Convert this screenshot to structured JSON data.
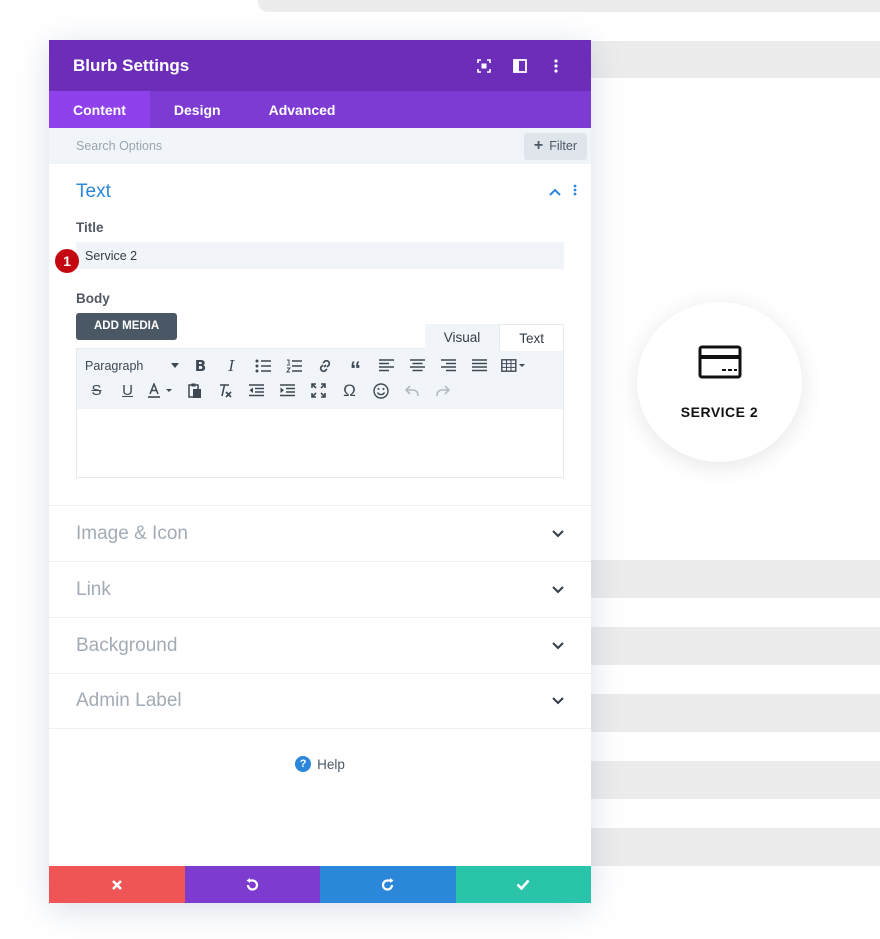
{
  "panel": {
    "title": "Blurb Settings",
    "tabs": [
      "Content",
      "Design",
      "Advanced"
    ],
    "search_placeholder": "Search Options",
    "filter_label": "Filter"
  },
  "text_section": {
    "title": "Text",
    "title_field_label": "Title",
    "title_value": "Service 2",
    "badge": "1",
    "body_label": "Body",
    "add_media": "ADD MEDIA",
    "editor_tabs": [
      "Visual",
      "Text"
    ],
    "paragraph_select": "Paragraph"
  },
  "collapsed_sections": [
    "Image & Icon",
    "Link",
    "Background",
    "Admin Label"
  ],
  "help_label": "Help",
  "footer_colors": {
    "cancel": "#ef5555",
    "undo": "#7d3bcf",
    "redo": "#2b87da",
    "save": "#29c4a9"
  },
  "colors": {
    "header": "#6c2eb9",
    "tabs": "#7d3bd4",
    "active_tab": "#8f42ec",
    "accent": "#2b87da",
    "badge": "#c4080f"
  },
  "preview": {
    "blurb_title": "SERVICE 2",
    "icon": "credit-card-icon"
  }
}
